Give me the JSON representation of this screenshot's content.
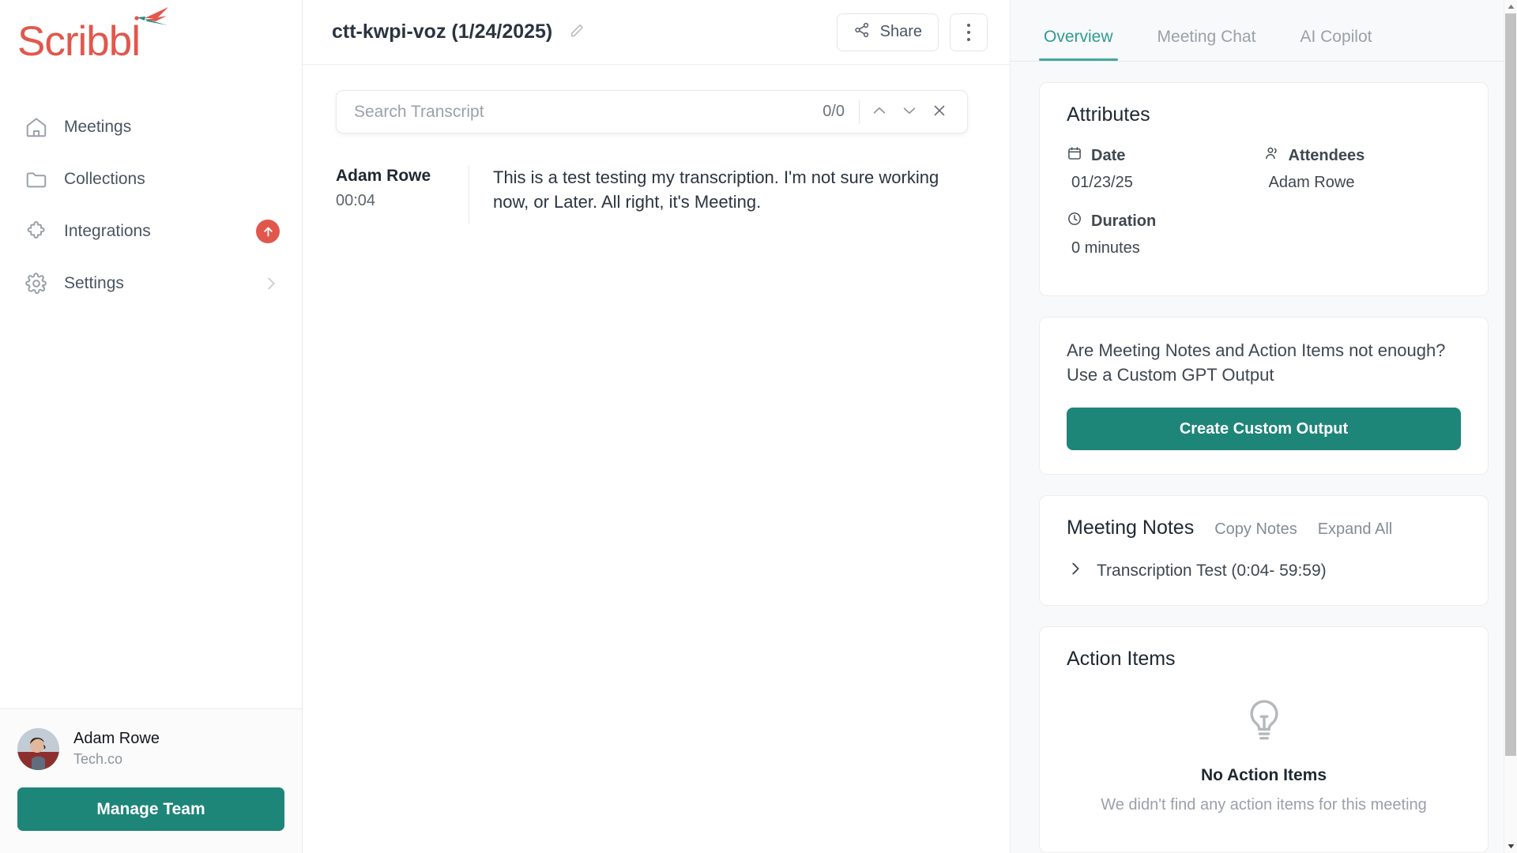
{
  "brand": {
    "name": "Scribbl",
    "logo_color": "#e2574c",
    "accent_teal": "#1e8579",
    "tab_active_color": "#2e9b94"
  },
  "sidebar": {
    "items": [
      {
        "label": "Meetings",
        "icon": "home-icon",
        "badge": null,
        "chevron": false
      },
      {
        "label": "Collections",
        "icon": "folder-icon",
        "badge": null,
        "chevron": false
      },
      {
        "label": "Integrations",
        "icon": "puzzle-icon",
        "badge": "arrow-up-badge",
        "chevron": false
      },
      {
        "label": "Settings",
        "icon": "gear-icon",
        "badge": null,
        "chevron": true
      }
    ],
    "profile": {
      "name": "Adam Rowe",
      "org": "Tech.co"
    },
    "manage_team_label": "Manage Team"
  },
  "header": {
    "title": "ctt-kwpi-voz (1/24/2025)",
    "edit_icon": "pencil-icon",
    "share_label": "Share",
    "share_icon": "share-network-icon",
    "more_icon": "kebab-menu-icon"
  },
  "search": {
    "placeholder": "Search Transcript",
    "value": "",
    "count": "0/0",
    "prev_icon": "chevron-up-icon",
    "next_icon": "chevron-down-icon",
    "close_icon": "close-icon"
  },
  "transcript": {
    "entries": [
      {
        "speaker": "Adam Rowe",
        "time": "00:04",
        "text": "This is a test testing my transcription. I'm not sure working now, or Later. All right, it's Meeting."
      }
    ]
  },
  "right_panel": {
    "tabs": [
      {
        "label": "Overview",
        "active": true
      },
      {
        "label": "Meeting Chat",
        "active": false
      },
      {
        "label": "AI Copilot",
        "active": false
      }
    ],
    "attributes": {
      "title": "Attributes",
      "date_label": "Date",
      "date_value": "01/23/25",
      "attendees_label": "Attendees",
      "attendees_value": "Adam Rowe",
      "duration_label": "Duration",
      "duration_value": "0 minutes"
    },
    "custom_gpt": {
      "prompt": "Are Meeting Notes and Action Items not enough? Use a Custom GPT Output",
      "button_label": "Create Custom Output"
    },
    "meeting_notes": {
      "title": "Meeting Notes",
      "copy_label": "Copy Notes",
      "expand_label": "Expand All",
      "sections": [
        {
          "label": "Transcription Test (0:04- 59:59)",
          "expanded": false
        }
      ]
    },
    "action_items": {
      "title": "Action Items",
      "empty_icon": "lightbulb-icon",
      "empty_title": "No Action Items",
      "empty_subtitle": "We didn't find any action items for this meeting"
    }
  }
}
